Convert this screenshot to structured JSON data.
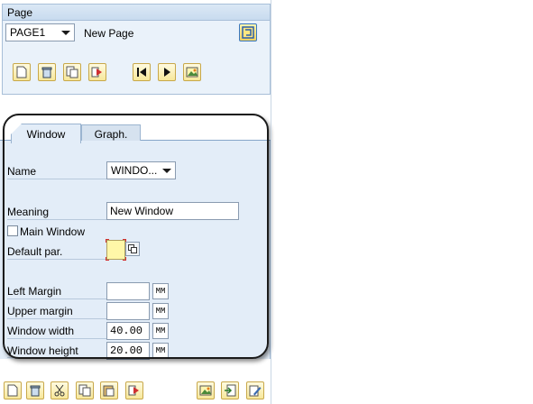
{
  "page_panel": {
    "title": "Page",
    "page_select": {
      "value": "PAGE1"
    },
    "page_description": "New Page",
    "toolbar": [
      {
        "name": "create-icon"
      },
      {
        "name": "delete-icon"
      },
      {
        "name": "copy-icon"
      },
      {
        "name": "rename-icon"
      },
      {
        "name": "first-page-icon"
      },
      {
        "name": "next-page-icon"
      },
      {
        "name": "picture-icon"
      }
    ]
  },
  "window_panel": {
    "tabs": [
      {
        "label": "Window",
        "active": true
      },
      {
        "label": "Graph.",
        "active": false
      }
    ],
    "name_label": "Name",
    "name_value": "WINDO...",
    "meaning_label": "Meaning",
    "meaning_value": "New Window",
    "main_window_label": "Main Window",
    "main_window_checked": false,
    "default_par_label": "Default par.",
    "left_margin_label": "Left Margin",
    "left_margin_value": "",
    "left_margin_unit": "MM",
    "upper_margin_label": "Upper margin",
    "upper_margin_value": "",
    "upper_margin_unit": "MM",
    "window_width_label": "Window width",
    "window_width_value": "40.00",
    "window_width_unit": "MM",
    "window_height_label": "Window height",
    "window_height_value": "20.00",
    "window_height_unit": "MM"
  },
  "bottom_toolbar": [
    {
      "name": "create-icon"
    },
    {
      "name": "delete-icon"
    },
    {
      "name": "cut-icon"
    },
    {
      "name": "copy-icon"
    },
    {
      "name": "paste-icon"
    },
    {
      "name": "rename-icon"
    },
    {
      "name": "picture-icon"
    },
    {
      "name": "import-icon"
    },
    {
      "name": "edit-icon"
    }
  ],
  "colors": {
    "panel_bg": "#e3edf8",
    "button_bg": "#f7e79a",
    "accent": "#d03030"
  }
}
